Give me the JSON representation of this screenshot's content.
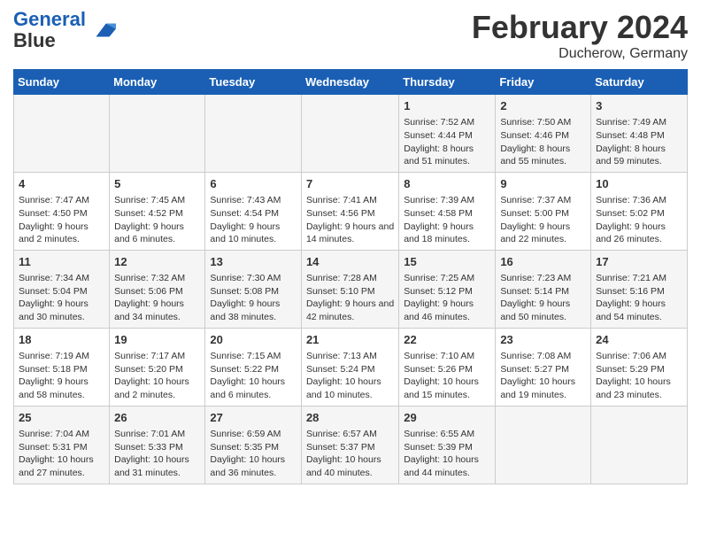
{
  "header": {
    "logo_line1": "General",
    "logo_line2": "Blue",
    "title": "February 2024",
    "subtitle": "Ducherow, Germany"
  },
  "days_of_week": [
    "Sunday",
    "Monday",
    "Tuesday",
    "Wednesday",
    "Thursday",
    "Friday",
    "Saturday"
  ],
  "weeks": [
    [
      {
        "day": "",
        "info": ""
      },
      {
        "day": "",
        "info": ""
      },
      {
        "day": "",
        "info": ""
      },
      {
        "day": "",
        "info": ""
      },
      {
        "day": "1",
        "info": "Sunrise: 7:52 AM\nSunset: 4:44 PM\nDaylight: 8 hours and 51 minutes."
      },
      {
        "day": "2",
        "info": "Sunrise: 7:50 AM\nSunset: 4:46 PM\nDaylight: 8 hours and 55 minutes."
      },
      {
        "day": "3",
        "info": "Sunrise: 7:49 AM\nSunset: 4:48 PM\nDaylight: 8 hours and 59 minutes."
      }
    ],
    [
      {
        "day": "4",
        "info": "Sunrise: 7:47 AM\nSunset: 4:50 PM\nDaylight: 9 hours and 2 minutes."
      },
      {
        "day": "5",
        "info": "Sunrise: 7:45 AM\nSunset: 4:52 PM\nDaylight: 9 hours and 6 minutes."
      },
      {
        "day": "6",
        "info": "Sunrise: 7:43 AM\nSunset: 4:54 PM\nDaylight: 9 hours and 10 minutes."
      },
      {
        "day": "7",
        "info": "Sunrise: 7:41 AM\nSunset: 4:56 PM\nDaylight: 9 hours and 14 minutes."
      },
      {
        "day": "8",
        "info": "Sunrise: 7:39 AM\nSunset: 4:58 PM\nDaylight: 9 hours and 18 minutes."
      },
      {
        "day": "9",
        "info": "Sunrise: 7:37 AM\nSunset: 5:00 PM\nDaylight: 9 hours and 22 minutes."
      },
      {
        "day": "10",
        "info": "Sunrise: 7:36 AM\nSunset: 5:02 PM\nDaylight: 9 hours and 26 minutes."
      }
    ],
    [
      {
        "day": "11",
        "info": "Sunrise: 7:34 AM\nSunset: 5:04 PM\nDaylight: 9 hours and 30 minutes."
      },
      {
        "day": "12",
        "info": "Sunrise: 7:32 AM\nSunset: 5:06 PM\nDaylight: 9 hours and 34 minutes."
      },
      {
        "day": "13",
        "info": "Sunrise: 7:30 AM\nSunset: 5:08 PM\nDaylight: 9 hours and 38 minutes."
      },
      {
        "day": "14",
        "info": "Sunrise: 7:28 AM\nSunset: 5:10 PM\nDaylight: 9 hours and 42 minutes."
      },
      {
        "day": "15",
        "info": "Sunrise: 7:25 AM\nSunset: 5:12 PM\nDaylight: 9 hours and 46 minutes."
      },
      {
        "day": "16",
        "info": "Sunrise: 7:23 AM\nSunset: 5:14 PM\nDaylight: 9 hours and 50 minutes."
      },
      {
        "day": "17",
        "info": "Sunrise: 7:21 AM\nSunset: 5:16 PM\nDaylight: 9 hours and 54 minutes."
      }
    ],
    [
      {
        "day": "18",
        "info": "Sunrise: 7:19 AM\nSunset: 5:18 PM\nDaylight: 9 hours and 58 minutes."
      },
      {
        "day": "19",
        "info": "Sunrise: 7:17 AM\nSunset: 5:20 PM\nDaylight: 10 hours and 2 minutes."
      },
      {
        "day": "20",
        "info": "Sunrise: 7:15 AM\nSunset: 5:22 PM\nDaylight: 10 hours and 6 minutes."
      },
      {
        "day": "21",
        "info": "Sunrise: 7:13 AM\nSunset: 5:24 PM\nDaylight: 10 hours and 10 minutes."
      },
      {
        "day": "22",
        "info": "Sunrise: 7:10 AM\nSunset: 5:26 PM\nDaylight: 10 hours and 15 minutes."
      },
      {
        "day": "23",
        "info": "Sunrise: 7:08 AM\nSunset: 5:27 PM\nDaylight: 10 hours and 19 minutes."
      },
      {
        "day": "24",
        "info": "Sunrise: 7:06 AM\nSunset: 5:29 PM\nDaylight: 10 hours and 23 minutes."
      }
    ],
    [
      {
        "day": "25",
        "info": "Sunrise: 7:04 AM\nSunset: 5:31 PM\nDaylight: 10 hours and 27 minutes."
      },
      {
        "day": "26",
        "info": "Sunrise: 7:01 AM\nSunset: 5:33 PM\nDaylight: 10 hours and 31 minutes."
      },
      {
        "day": "27",
        "info": "Sunrise: 6:59 AM\nSunset: 5:35 PM\nDaylight: 10 hours and 36 minutes."
      },
      {
        "day": "28",
        "info": "Sunrise: 6:57 AM\nSunset: 5:37 PM\nDaylight: 10 hours and 40 minutes."
      },
      {
        "day": "29",
        "info": "Sunrise: 6:55 AM\nSunset: 5:39 PM\nDaylight: 10 hours and 44 minutes."
      },
      {
        "day": "",
        "info": ""
      },
      {
        "day": "",
        "info": ""
      }
    ]
  ]
}
